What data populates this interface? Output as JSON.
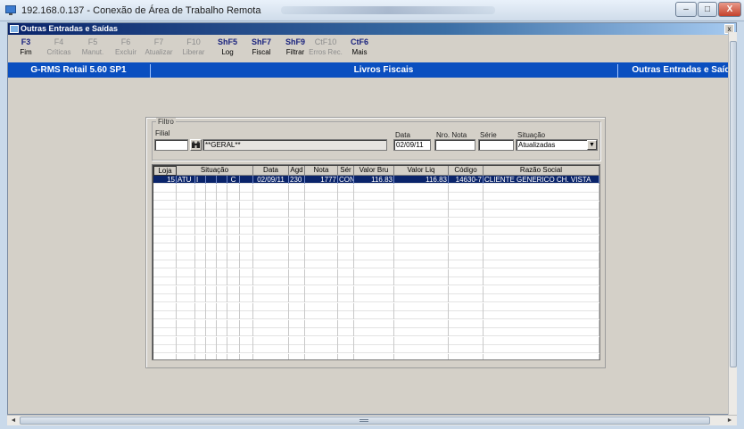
{
  "rdp": {
    "title": "192.168.0.137 - Conexão de Área de Trabalho Remota",
    "minimize": "–",
    "maximize": "□",
    "close": "X"
  },
  "app": {
    "title": "Outras Entradas e Saídas",
    "title_btn": "x"
  },
  "fkeys": [
    {
      "key": "F3",
      "label": "Fim",
      "enabled": true
    },
    {
      "key": "F4",
      "label": "Críticas",
      "enabled": false
    },
    {
      "key": "F5",
      "label": "Manut.",
      "enabled": false
    },
    {
      "key": "F6",
      "label": "Excluir",
      "enabled": false
    },
    {
      "key": "F7",
      "label": "Atualizar",
      "enabled": false
    },
    {
      "key": "F10",
      "label": "Liberar",
      "enabled": false
    },
    {
      "key": "ShF5",
      "label": "Log",
      "enabled": true
    },
    {
      "key": "ShF7",
      "label": "Fiscal",
      "enabled": true
    },
    {
      "key": "ShF9",
      "label": "Filtrar",
      "enabled": true
    },
    {
      "key": "CtF10",
      "label": "Erros Rec.",
      "enabled": false
    },
    {
      "key": "CtF6",
      "label": "Mais",
      "enabled": true
    }
  ],
  "bar": {
    "left": "G-RMS Retail 5.60 SP1",
    "center": "Livros Fiscais",
    "right": "Outras Entradas e Saída"
  },
  "filter": {
    "group_title": "Filtro",
    "filial_label": "Filial",
    "filial_value": "",
    "filial_desc": "**GERAL**",
    "data_label": "Data",
    "data_value": "02/09/11",
    "nro_nota_label": "Nro. Nota",
    "nro_nota_value": "",
    "serie_label": "Série",
    "serie_value": "",
    "situacao_label": "Situação",
    "situacao_value": "Atualizadas"
  },
  "grid": {
    "headers": {
      "loja": "Loja",
      "situacao": "Situação",
      "data": "Data",
      "agd": "Agd",
      "nota": "Nota",
      "ser": "Sér",
      "valor_bru": "Valor Bru",
      "valor_liq": "Valor Liq",
      "codigo": "Código",
      "razao": "Razão Social"
    },
    "rows": [
      {
        "loja": "15",
        "sit1": "ATU",
        "sit2": "I",
        "sit3": "",
        "sit4": "",
        "sit5": "C",
        "sit6": "",
        "data": "02/09/11",
        "agd": "230",
        "nota": "1777",
        "ser": "CON",
        "valor_bru": "116.83",
        "valor_liq": "116.83",
        "codigo": "14630-7",
        "razao": "CLIENTE GENERICO CH. VISTA"
      }
    ]
  }
}
